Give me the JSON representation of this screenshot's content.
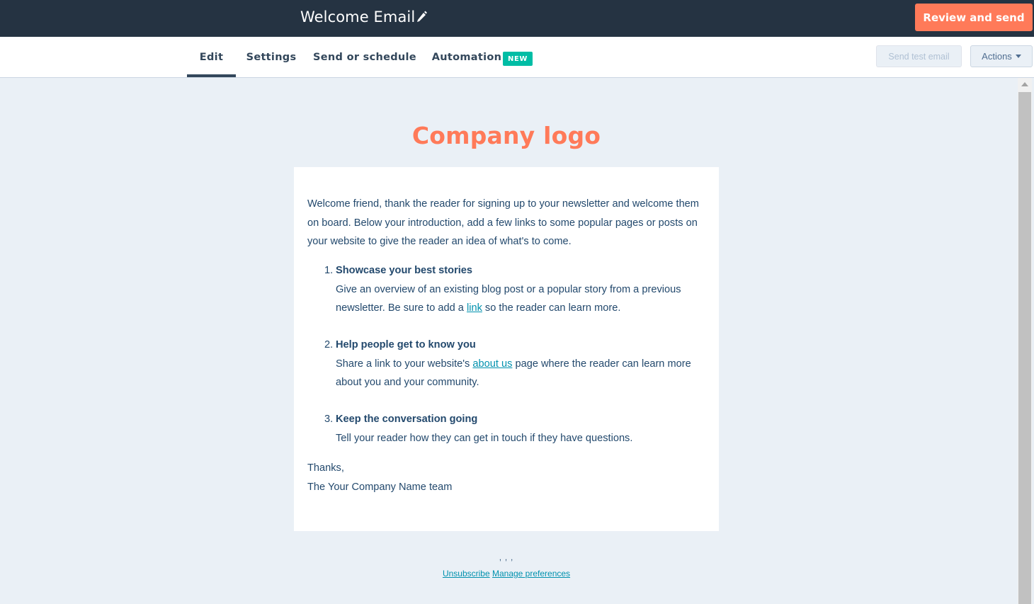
{
  "header": {
    "email_name": "Welcome Email",
    "review_button": "Review and send"
  },
  "tabs": {
    "edit": "Edit",
    "settings": "Settings",
    "send": "Send or schedule",
    "automation": "Automation",
    "automation_badge": "NEW",
    "active": "Edit"
  },
  "toolbar": {
    "send_test": "Send test email",
    "actions": "Actions"
  },
  "email": {
    "logo_text": "Company logo",
    "intro": "Welcome friend, thank the reader for signing up to your newsletter and welcome them on board. Below your introduction, add a few links to some popular pages or posts on your website to give the reader an idea of what's to come.",
    "items": [
      {
        "number": "1.",
        "heading": "Showcase your best stories",
        "body_before": "Give an overview of an existing blog post or a popular story from a previous newsletter. Be sure to add a ",
        "link": "link",
        "body_after": " so the reader can learn more."
      },
      {
        "number": "2.",
        "heading": "Help people get to know you",
        "body_before": "Share a link to your website's ",
        "link": "about us",
        "body_after": " page where the reader can learn more about you and your community."
      },
      {
        "number": "3.",
        "heading": "Keep the conversation going",
        "body": "Tell your reader how they can get in touch if they have questions."
      }
    ],
    "signoff": "Thanks,",
    "signature": "The Your Company Name team"
  },
  "footer": {
    "address": ", , ,",
    "unsubscribe": "Unsubscribe",
    "manage": "Manage preferences"
  },
  "colors": {
    "topbar": "#253342",
    "accent": "#ff7a59",
    "badge": "#00bda5",
    "link": "#0091ae",
    "canvas": "#eaf0f6"
  }
}
